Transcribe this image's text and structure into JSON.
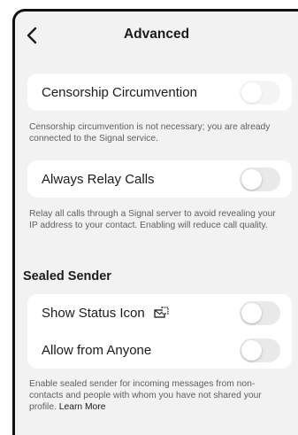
{
  "header": {
    "title": "Advanced",
    "back_icon": "chevron-left-icon"
  },
  "censorship": {
    "label": "Censorship Circumvention",
    "toggle_on": false,
    "toggle_enabled": false,
    "description": "Censorship circumvention is not necessary; you are already connected to the Signal service."
  },
  "relay_calls": {
    "label": "Always Relay Calls",
    "toggle_on": false,
    "description": "Relay all calls through a Signal server to avoid revealing your IP address to your contact. Enabling will reduce call quality."
  },
  "sealed_sender": {
    "title": "Sealed Sender",
    "show_status_icon": {
      "label": "Show Status Icon",
      "icon": "sealed-sender-icon",
      "toggle_on": false
    },
    "allow_from_anyone": {
      "label": "Allow from Anyone",
      "toggle_on": false
    },
    "description": "Enable sealed sender for incoming messages from non-contacts and people with whom you have not shared your profile.",
    "learn_more": "Learn More"
  },
  "colors": {
    "background": "#f2f2f3",
    "card": "#ffffff",
    "toggle_off": "#e9e9eb",
    "text_primary": "#1b1b1b",
    "text_secondary": "#5e5e62"
  }
}
